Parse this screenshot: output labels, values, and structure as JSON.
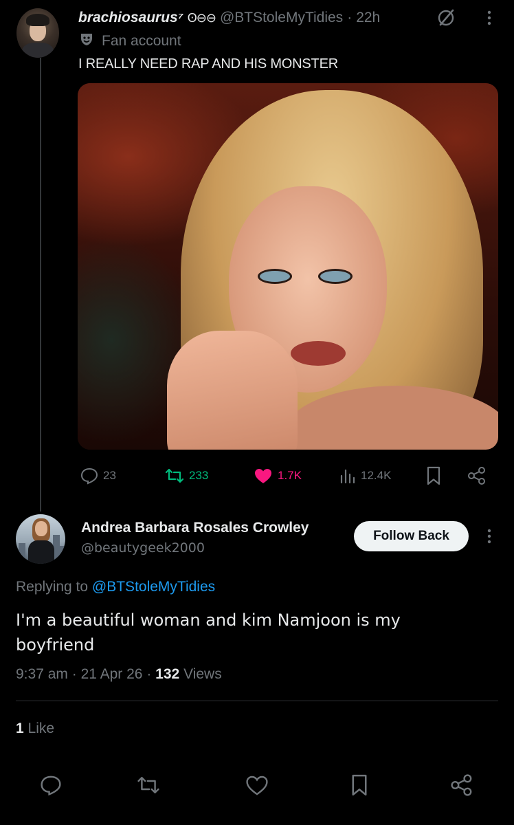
{
  "parent_tweet": {
    "display_name": "brachiosaurus⁷",
    "badges": "ʘ⊖⊖",
    "handle": "@BTStoleMyTidies",
    "time_sep": "·",
    "time": "22h",
    "label": "Fan account",
    "text": "I REALLY NEED RAP AND HIS MONSTER",
    "stats": {
      "replies": "23",
      "reposts": "233",
      "likes": "1.7K",
      "views": "12.4K"
    }
  },
  "reply": {
    "display_name": "Andrea Barbara Rosales Crowley",
    "handle": "@beautygeek2000",
    "follow_label": "Follow Back",
    "replying_prefix": "Replying to",
    "replying_mention": "@BTStoleMyTidies",
    "text": "I'm a beautiful woman and kim Namjoon is my boyfriend",
    "time": "9:37 am",
    "sep1": "·",
    "date": "21 Apr 26",
    "sep2": "·",
    "views_count": "132",
    "views_label": "Views",
    "likes_count": "1",
    "likes_label": "Like"
  },
  "colors": {
    "background": "#000000",
    "text_primary": "#e7e9ea",
    "text_secondary": "#71767b",
    "accent_blue": "#1d9bf0",
    "repost_green": "#00ba7c",
    "like_pink": "#f91880"
  },
  "icons": {
    "parent_actions": [
      "reply-icon",
      "repost-icon",
      "like-icon",
      "views-icon",
      "bookmark-icon",
      "share-icon"
    ],
    "reply_actions": [
      "reply-icon",
      "repost-icon",
      "like-icon",
      "bookmark-icon",
      "share-icon"
    ]
  }
}
